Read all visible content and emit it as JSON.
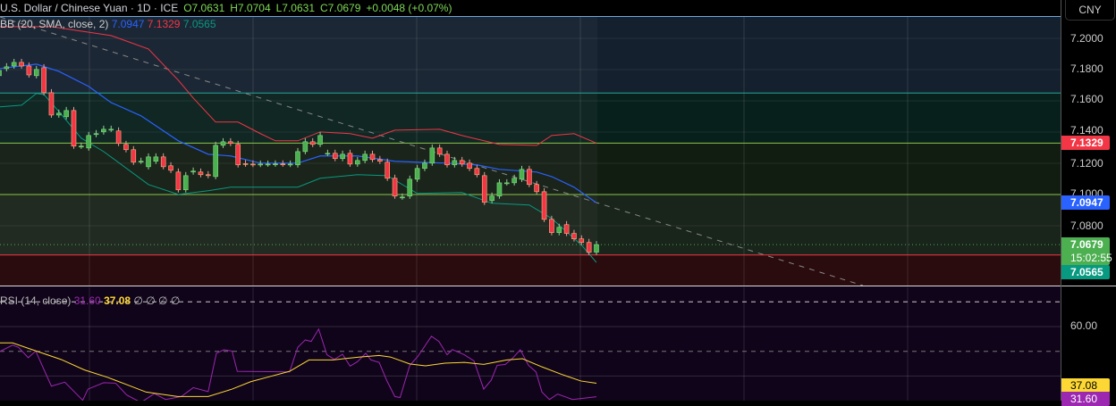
{
  "header": {
    "symbol": "U.S. Dollar / Chinese Yuan · 1D · ICE",
    "open": "O7.0631",
    "high": "H7.0704",
    "low": "L7.0631",
    "close": "C7.0679",
    "change": "+0.0048 (+0.07%)"
  },
  "bb_legend": {
    "label": "BB (20, SMA, close, 2)",
    "basis": "7.0947",
    "upper": "7.1329",
    "lower": "7.0565"
  },
  "rsi_legend": {
    "label": "RSI (14, close)",
    "rsi": "31.60",
    "ma": "37.08",
    "extras": "∅ ∅ ∅ ∅"
  },
  "axis": {
    "currency": "CNY",
    "ticks": [
      "7.2000",
      "7.1800",
      "7.1600",
      "7.1400",
      "7.1200",
      "7.1000",
      "7.0800"
    ],
    "rsi_ticks": [
      "60.00"
    ],
    "labels": {
      "upper": "7.1329",
      "basis": "7.0947",
      "last": "7.0679",
      "countdown": "15:02:55",
      "lower": "7.0565",
      "rsi_ma": "37.08",
      "rsi": "31.60"
    }
  },
  "colors": {
    "up": "#4caf50",
    "down": "#f23645",
    "upper": "#f23645",
    "basis": "#2962ff",
    "lower": "#089981",
    "rsi": "#9c27b0",
    "rsi_ma": "#fdd835"
  },
  "chart_data": {
    "type": "candlestick",
    "candles_oc": [
      [
        7.1761,
        7.1795
      ],
      [
        7.1806,
        7.1818
      ],
      [
        7.1823,
        7.1846
      ],
      [
        7.1846,
        7.1823
      ],
      [
        7.1823,
        7.1766
      ],
      [
        7.1761,
        7.1801
      ],
      [
        7.1812,
        7.1652
      ],
      [
        7.1652,
        7.1509
      ],
      [
        7.1509,
        7.1521
      ],
      [
        7.1498,
        7.1538
      ],
      [
        7.1538,
        7.131
      ],
      [
        7.131,
        7.131
      ],
      [
        7.1298,
        7.1378
      ],
      [
        7.1384,
        7.139
      ],
      [
        7.1401,
        7.1418
      ],
      [
        7.1418,
        7.1418
      ],
      [
        7.1407,
        7.1327
      ],
      [
        7.1321,
        7.1287
      ],
      [
        7.1287,
        7.1207
      ],
      [
        7.1213,
        7.1213
      ],
      [
        7.1178,
        7.1241
      ],
      [
        7.1213,
        7.1241
      ],
      [
        7.1241,
        7.1178
      ],
      [
        7.1184,
        7.1155
      ],
      [
        7.1144,
        7.103
      ],
      [
        7.103,
        7.1121
      ],
      [
        7.1144,
        7.115
      ],
      [
        7.1144,
        7.1127
      ],
      [
        7.1127,
        7.1121
      ],
      [
        7.1115,
        7.1315
      ],
      [
        7.1315,
        7.1338
      ],
      [
        7.1338,
        7.1327
      ],
      [
        7.1321,
        7.119
      ],
      [
        7.1198,
        7.1195
      ],
      [
        7.1195,
        7.1193
      ],
      [
        7.1193,
        7.1195
      ],
      [
        7.1195,
        7.1195
      ],
      [
        7.1195,
        7.1196
      ],
      [
        7.1196,
        7.1195
      ],
      [
        7.1193,
        7.1195
      ],
      [
        7.119,
        7.1275
      ],
      [
        7.1275,
        7.1338
      ],
      [
        7.1338,
        7.1321
      ],
      [
        7.1321,
        7.1378
      ],
      [
        7.1264,
        7.1264
      ],
      [
        7.1264,
        7.123
      ],
      [
        7.123,
        7.1258
      ],
      [
        7.1264,
        7.1195
      ],
      [
        7.1195,
        7.1218
      ],
      [
        7.1218,
        7.1258
      ],
      [
        7.1258,
        7.1224
      ],
      [
        7.1224,
        7.1213
      ],
      [
        7.1207,
        7.1104
      ],
      [
        7.1104,
        7.099
      ],
      [
        7.0984,
        7.0984
      ],
      [
        7.099,
        7.1098
      ],
      [
        7.1098,
        7.1167
      ],
      [
        7.1167,
        7.1201
      ],
      [
        7.1201,
        7.1298
      ],
      [
        7.1298,
        7.1258
      ],
      [
        7.1258,
        7.119
      ],
      [
        7.119,
        7.1218
      ],
      [
        7.1218,
        7.1195
      ],
      [
        7.1201,
        7.1167
      ],
      [
        7.1167,
        7.1127
      ],
      [
        7.1121,
        7.095
      ],
      [
        7.0961,
        7.099
      ],
      [
        7.099,
        7.1075
      ],
      [
        7.1075,
        7.1075
      ],
      [
        7.1075,
        7.1104
      ],
      [
        7.1098,
        7.1161
      ],
      [
        7.1161,
        7.1064
      ],
      [
        7.1064,
        7.1018
      ],
      [
        7.1018,
        7.0841
      ],
      [
        7.0841,
        7.0756
      ],
      [
        7.0756,
        7.079
      ],
      [
        7.0807,
        7.0751
      ],
      [
        7.0751,
        7.0716
      ],
      [
        7.0716,
        7.0693
      ],
      [
        7.0693,
        7.063
      ],
      [
        7.0631,
        7.0679
      ]
    ],
    "bb_upper": [
      [
        1,
        7.2075
      ],
      [
        8,
        7.2075
      ],
      [
        16,
        7.2018
      ],
      [
        21,
        7.1932
      ],
      [
        25,
        7.1732
      ],
      [
        27,
        7.1618
      ],
      [
        30,
        7.1464
      ],
      [
        33,
        7.1464
      ],
      [
        36,
        7.139
      ],
      [
        38,
        7.1344
      ],
      [
        41,
        7.1344
      ],
      [
        44,
        7.1401
      ],
      [
        48,
        7.139
      ],
      [
        51,
        7.1361
      ],
      [
        54,
        7.1412
      ],
      [
        60,
        7.1418
      ],
      [
        63,
        7.1378
      ],
      [
        68,
        7.1321
      ],
      [
        73,
        7.1315
      ],
      [
        75,
        7.1378
      ],
      [
        78,
        7.139
      ],
      [
        81,
        7.1329
      ]
    ],
    "bb_basis": [
      [
        1,
        7.1806
      ],
      [
        6,
        7.1835
      ],
      [
        9,
        7.1789
      ],
      [
        13,
        7.1692
      ],
      [
        16,
        7.1589
      ],
      [
        20,
        7.1504
      ],
      [
        25,
        7.1344
      ],
      [
        29,
        7.1258
      ],
      [
        32,
        7.1247
      ],
      [
        36,
        7.1201
      ],
      [
        41,
        7.1201
      ],
      [
        44,
        7.1247
      ],
      [
        49,
        7.1247
      ],
      [
        54,
        7.1213
      ],
      [
        57,
        7.1207
      ],
      [
        61,
        7.1201
      ],
      [
        65,
        7.119
      ],
      [
        68,
        7.1161
      ],
      [
        73,
        7.1144
      ],
      [
        75,
        7.1115
      ],
      [
        78,
        7.1047
      ],
      [
        81,
        7.0947
      ]
    ],
    "bb_lower": [
      [
        1,
        7.1561
      ],
      [
        4,
        7.1572
      ],
      [
        6,
        7.1647
      ],
      [
        7,
        7.1641
      ],
      [
        9,
        7.1532
      ],
      [
        12,
        7.1361
      ],
      [
        15,
        7.1275
      ],
      [
        21,
        7.1064
      ],
      [
        25,
        7.1001
      ],
      [
        29,
        7.1024
      ],
      [
        32,
        7.1047
      ],
      [
        41,
        7.1047
      ],
      [
        44,
        7.1104
      ],
      [
        49,
        7.1127
      ],
      [
        53,
        7.1121
      ],
      [
        57,
        7.1007
      ],
      [
        63,
        7.1013
      ],
      [
        67,
        7.0944
      ],
      [
        72,
        7.0933
      ],
      [
        75,
        7.0847
      ],
      [
        79,
        7.0676
      ],
      [
        81,
        7.0565
      ]
    ],
    "levels": [
      7.165,
      7.1329,
      7.1,
      7.0613
    ],
    "rsi": [
      [
        1,
        49.8
      ],
      [
        2.8,
        52.5
      ],
      [
        3.6,
        51.6
      ],
      [
        4.9,
        47.4
      ],
      [
        5.9,
        50.1
      ],
      [
        8,
        35.9
      ],
      [
        9.8,
        37.5
      ],
      [
        12.2,
        30.2
      ],
      [
        12.9,
        34.7
      ],
      [
        15,
        37.3
      ],
      [
        16.6,
        37.1
      ],
      [
        18.1,
        32.3
      ],
      [
        20,
        29.3
      ],
      [
        21.8,
        32.9
      ],
      [
        23.3,
        30.5
      ],
      [
        25.4,
        31.7
      ],
      [
        27,
        35.3
      ],
      [
        29,
        33.7
      ],
      [
        30.1,
        49.2
      ],
      [
        31.1,
        50.6
      ],
      [
        32.2,
        50.1
      ],
      [
        32.9,
        41.9
      ],
      [
        39.9,
        41.7
      ],
      [
        41,
        51.6
      ],
      [
        42,
        54.6
      ],
      [
        42.8,
        54
      ],
      [
        43.8,
        59
      ],
      [
        44.9,
        48.6
      ],
      [
        45.9,
        46.7
      ],
      [
        47,
        48.8
      ],
      [
        48,
        44
      ],
      [
        49,
        45.8
      ],
      [
        50.1,
        49.2
      ],
      [
        50.8,
        46.5
      ],
      [
        51.9,
        45.5
      ],
      [
        52.9,
        38.3
      ],
      [
        54,
        31.7
      ],
      [
        54.7,
        31.3
      ],
      [
        56,
        44.3
      ],
      [
        57.1,
        48
      ],
      [
        58.9,
        56.1
      ],
      [
        59.9,
        54
      ],
      [
        61,
        48.6
      ],
      [
        61.7,
        50.7
      ],
      [
        63.3,
        48.6
      ],
      [
        64.6,
        46.1
      ],
      [
        65.9,
        34.7
      ],
      [
        66.9,
        38.3
      ],
      [
        67.7,
        44.3
      ],
      [
        68.8,
        44.7
      ],
      [
        69.8,
        47.3
      ],
      [
        70.8,
        50.6
      ],
      [
        71.9,
        44.3
      ],
      [
        72.9,
        41.7
      ],
      [
        73.7,
        33.5
      ],
      [
        74.7,
        30.5
      ],
      [
        75.8,
        32.7
      ],
      [
        77.8,
        30.5
      ],
      [
        81,
        31.6
      ]
    ],
    "rsi_ma": [
      [
        1,
        53.4
      ],
      [
        2.8,
        53.4
      ],
      [
        5.7,
        50.4
      ],
      [
        9.3,
        46.7
      ],
      [
        12.4,
        42.5
      ],
      [
        15.5,
        39.5
      ],
      [
        18.1,
        36.5
      ],
      [
        20.7,
        33.5
      ],
      [
        24.9,
        31.7
      ],
      [
        29,
        31.7
      ],
      [
        32.2,
        34.7
      ],
      [
        34.7,
        37.7
      ],
      [
        37.3,
        39.8
      ],
      [
        39.9,
        41.9
      ],
      [
        42.5,
        46.5
      ],
      [
        45.7,
        46.5
      ],
      [
        49.3,
        47.7
      ],
      [
        51.9,
        48.3
      ],
      [
        53.4,
        47.7
      ],
      [
        56,
        44.9
      ],
      [
        58.1,
        44.1
      ],
      [
        60.7,
        45.2
      ],
      [
        63.3,
        45.5
      ],
      [
        65.9,
        44.7
      ],
      [
        69,
        46.5
      ],
      [
        71.1,
        47
      ],
      [
        73.7,
        43.7
      ],
      [
        76.3,
        40.7
      ],
      [
        78.9,
        38
      ],
      [
        81,
        37.08
      ]
    ],
    "rsi_levels": [
      70,
      60,
      50,
      40
    ]
  }
}
